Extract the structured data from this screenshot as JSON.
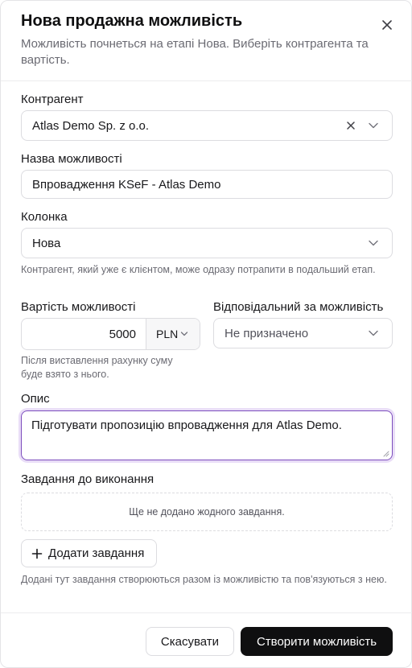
{
  "dialog": {
    "title": "Нова продажна можливість",
    "subtitle": "Можливість почнеться на етапі Нова. Виберіть контрагента та вартість."
  },
  "contractor": {
    "label": "Контрагент",
    "value": "Atlas Demo Sp. z o.o."
  },
  "name": {
    "label": "Назва можливості",
    "value": "Впровадження KSeF - Atlas Demo"
  },
  "column": {
    "label": "Колонка",
    "value": "Нова",
    "hint": "Контрагент, який уже є клієнтом, може одразу потрапити в подальший етап."
  },
  "value": {
    "label": "Вартість можливості",
    "amount": "5000",
    "currency": "PLN",
    "hint": "Після виставлення рахунку суму буде взято з нього."
  },
  "owner": {
    "label": "Відповідальний за можливість",
    "value": "Не призначено"
  },
  "description": {
    "label": "Опис",
    "value": "Підготувати пропозицію впровадження для Atlas Demo."
  },
  "tasks": {
    "label": "Завдання до виконання",
    "empty": "Ще не додано жодного завдання.",
    "add_label": "Додати завдання",
    "hint": "Додані тут завдання створюються разом із можливістю та пов'язуються з нею."
  },
  "footer": {
    "cancel_label": "Скасувати",
    "create_label": "Створити можливість"
  },
  "icons": {
    "close": "close-icon",
    "clear": "clear-icon",
    "chevron": "chevron-down-icon",
    "plus": "plus-icon"
  },
  "colors": {
    "accent_focus": "#7c4dbd",
    "primary_button": "#0f0f10"
  }
}
